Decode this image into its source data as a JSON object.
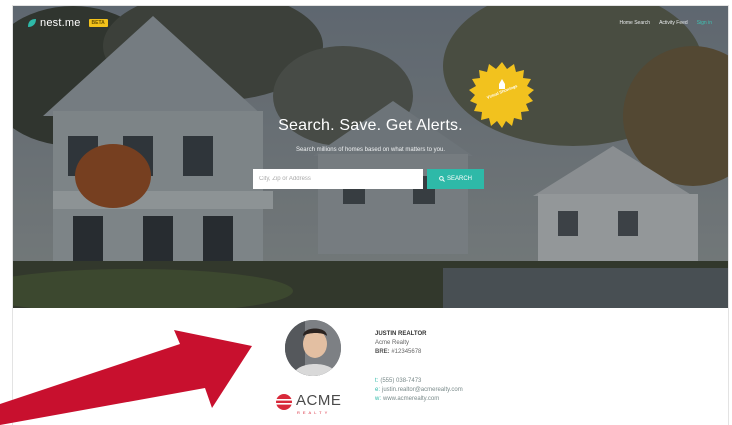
{
  "header": {
    "logo_text": "nest.me",
    "beta_label": "BETA",
    "nav": [
      "Home Search",
      "Activity Feed",
      "Sign in"
    ]
  },
  "badge": {
    "text": "Virtual Showings"
  },
  "hero": {
    "title": "Search. Save. Get Alerts.",
    "subtitle": "Search millions of homes based on what matters to you.",
    "search_placeholder": "City, Zip or Address",
    "search_button": "SEARCH"
  },
  "agent": {
    "name": "JUSTIN REALTOR",
    "company": "Acme Realty",
    "bre_label": "BRE:",
    "bre_number": "#12345678",
    "phone_label": "t:",
    "phone": "(555) 038-7473",
    "email_label": "e:",
    "email": "justin.realtor@acmerealty.com",
    "web_label": "w:",
    "web": "www.acmerealty.com"
  },
  "brand": {
    "word": "ACME",
    "sub": "REALTY"
  },
  "colors": {
    "accent": "#2eb9a8",
    "beta": "#f3c21b",
    "badge": "#f2c21e",
    "arrow": "#c8102e",
    "acme_red": "#d8293a"
  }
}
